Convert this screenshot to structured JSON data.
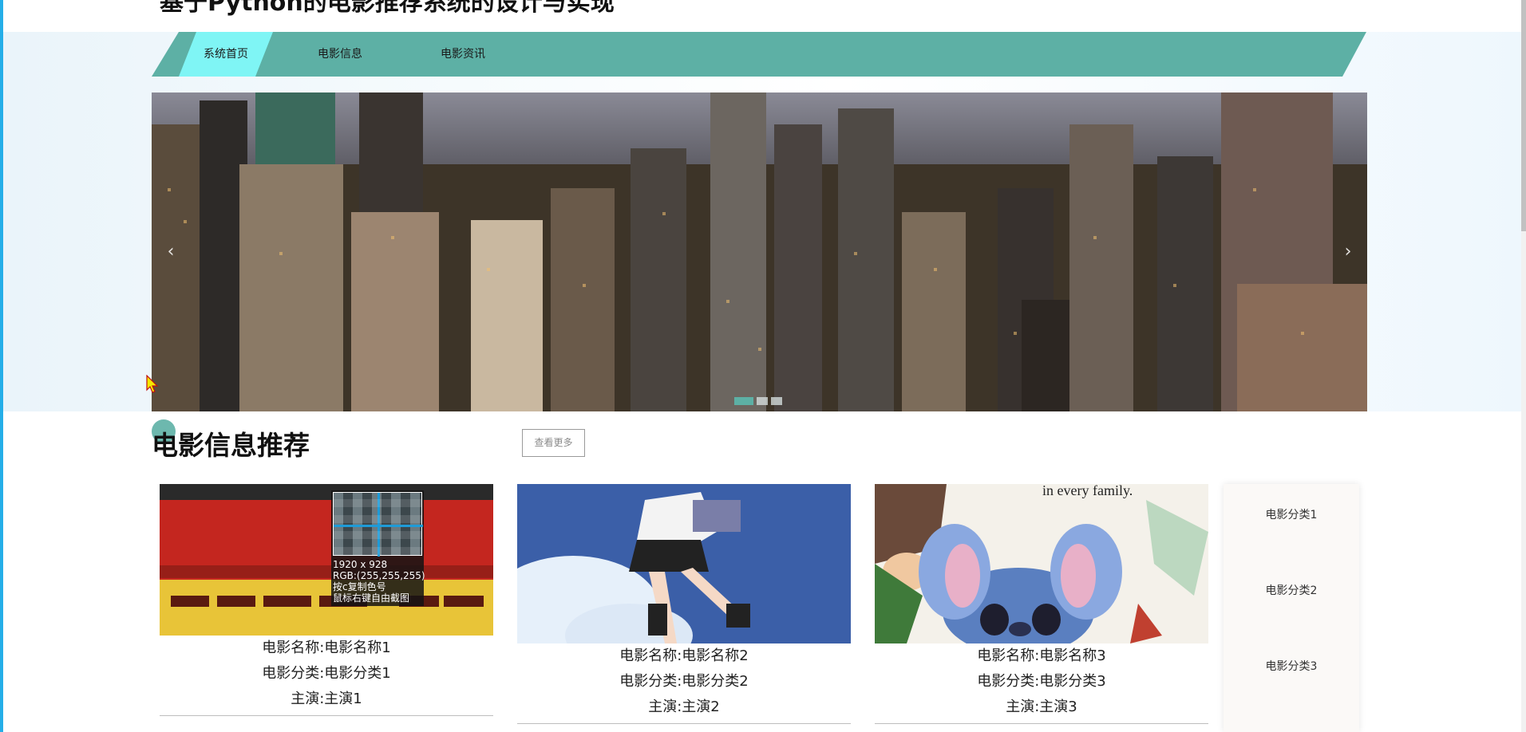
{
  "site": {
    "title": "基于Python的电影推荐系统的设计与实现"
  },
  "nav": {
    "items": [
      {
        "label": "系统首页",
        "active": true
      },
      {
        "label": "电影信息",
        "active": false
      },
      {
        "label": "电影资讯",
        "active": false
      }
    ]
  },
  "banner": {
    "prev": "‹",
    "next": "›",
    "slide_count": 3,
    "active_slide": 1
  },
  "section": {
    "title": "电影信息推荐",
    "more_label": "查看更多"
  },
  "cards": [
    {
      "name": "电影名称:电影名称1",
      "category": "电影分类:电影分类1",
      "actor": "主演:主演1"
    },
    {
      "name": "电影名称:电影名称2",
      "category": "电影分类:电影分类2",
      "actor": "主演:主演2"
    },
    {
      "name": "电影名称:电影名称3",
      "category": "电影分类:电影分类3",
      "actor": "主演:主演3"
    }
  ],
  "poster3_text": "in every family.",
  "categories": [
    "电影分类1",
    "电影分类2",
    "电影分类3"
  ],
  "color_picker": {
    "line1": "1920 x 928",
    "line2": "RGB:(255,255,255)",
    "line3": "按c复制色号",
    "line4": "鼠标右键自由截图"
  },
  "colors": {
    "accent": "#5db0a5",
    "active_nav": "#7ff5f5",
    "border": "#25aee8"
  }
}
